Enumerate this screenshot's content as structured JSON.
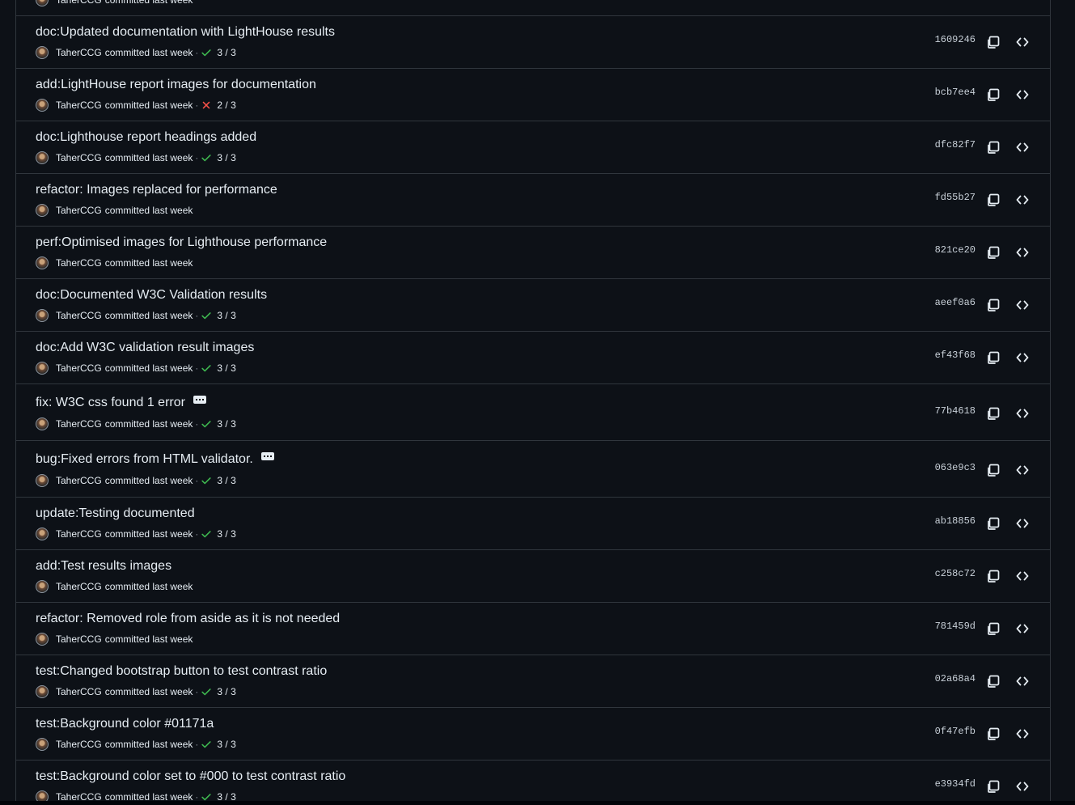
{
  "colors": {
    "background": "#0d1117",
    "border": "#30363d",
    "success": "#3fb950",
    "failure": "#f85149",
    "text": "#e6edf3",
    "muted": "#8b949e"
  },
  "commits": [
    {
      "message": "",
      "author": "TaherCCG",
      "committed": "committed last week",
      "status": "",
      "status_icon": "",
      "sha": "",
      "more": false
    },
    {
      "message": "doc:Updated documentation with LightHouse results",
      "author": "TaherCCG",
      "committed": "committed last week",
      "status": "3 / 3",
      "status_icon": "check-icon",
      "sha": "1609246",
      "more": false
    },
    {
      "message": "add:LightHouse report images for documentation",
      "author": "TaherCCG",
      "committed": "committed last week",
      "status": "2 / 3",
      "status_icon": "x-icon",
      "sha": "bcb7ee4",
      "more": false
    },
    {
      "message": "doc:Lighthouse report headings added",
      "author": "TaherCCG",
      "committed": "committed last week",
      "status": "3 / 3",
      "status_icon": "check-icon",
      "sha": "dfc82f7",
      "more": false
    },
    {
      "message": "refactor: Images replaced for performance",
      "author": "TaherCCG",
      "committed": "committed last week",
      "status": "",
      "status_icon": "",
      "sha": "fd55b27",
      "more": false
    },
    {
      "message": "perf:Optimised images for Lighthouse performance",
      "author": "TaherCCG",
      "committed": "committed last week",
      "status": "",
      "status_icon": "",
      "sha": "821ce20",
      "more": false
    },
    {
      "message": "doc:Documented W3C Validation results",
      "author": "TaherCCG",
      "committed": "committed last week",
      "status": "3 / 3",
      "status_icon": "check-icon",
      "sha": "aeef0a6",
      "more": false
    },
    {
      "message": "doc:Add W3C validation result images",
      "author": "TaherCCG",
      "committed": "committed last week",
      "status": "3 / 3",
      "status_icon": "check-icon",
      "sha": "ef43f68",
      "more": false
    },
    {
      "message": "fix: W3C css found 1 error",
      "author": "TaherCCG",
      "committed": "committed last week",
      "status": "3 / 3",
      "status_icon": "check-icon",
      "sha": "77b4618",
      "more": true
    },
    {
      "message": "bug:Fixed errors from HTML validator.",
      "author": "TaherCCG",
      "committed": "committed last week",
      "status": "3 / 3",
      "status_icon": "check-icon",
      "sha": "063e9c3",
      "more": true
    },
    {
      "message": "update:Testing documented",
      "author": "TaherCCG",
      "committed": "committed last week",
      "status": "3 / 3",
      "status_icon": "check-icon",
      "sha": "ab18856",
      "more": false
    },
    {
      "message": "add:Test results images",
      "author": "TaherCCG",
      "committed": "committed last week",
      "status": "",
      "status_icon": "",
      "sha": "c258c72",
      "more": false
    },
    {
      "message": "refactor: Removed role from aside as it is not needed",
      "author": "TaherCCG",
      "committed": "committed last week",
      "status": "",
      "status_icon": "",
      "sha": "781459d",
      "more": false
    },
    {
      "message": "test:Changed bootstrap button to test contrast ratio",
      "author": "TaherCCG",
      "committed": "committed last week",
      "status": "3 / 3",
      "status_icon": "check-icon",
      "sha": "02a68a4",
      "more": false
    },
    {
      "message": "test:Background color #01171a",
      "author": "TaherCCG",
      "committed": "committed last week",
      "status": "3 / 3",
      "status_icon": "check-icon",
      "sha": "0f47efb",
      "more": false
    },
    {
      "message": "test:Background color set to #000 to test contrast ratio",
      "author": "TaherCCG",
      "committed": "committed last week",
      "status": "3 / 3",
      "status_icon": "check-icon",
      "sha": "e3934fd",
      "more": false
    }
  ]
}
